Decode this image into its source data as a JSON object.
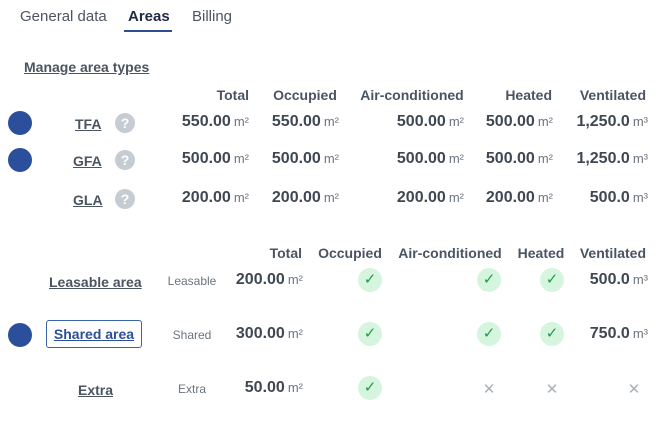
{
  "tabs": [
    {
      "label": "General data",
      "active": false
    },
    {
      "label": "Areas",
      "active": true
    },
    {
      "label": "Billing",
      "active": false
    }
  ],
  "manage_link": "Manage area types",
  "area_types_table": {
    "headers": [
      "Total",
      "Occupied",
      "Air-conditioned",
      "Heated",
      "Ventilated"
    ],
    "rows": [
      {
        "name": "TFA",
        "has_dot": true,
        "help": "?",
        "total": "550.00",
        "occupied": "550.00",
        "air_conditioned": "500.00",
        "heated": "500.00",
        "ventilated": "1,250.0"
      },
      {
        "name": "GFA",
        "has_dot": true,
        "help": "?",
        "total": "500.00",
        "occupied": "500.00",
        "air_conditioned": "500.00",
        "heated": "500.00",
        "ventilated": "1,250.0"
      },
      {
        "name": "GLA",
        "has_dot": false,
        "help": "?",
        "total": "200.00",
        "occupied": "200.00",
        "air_conditioned": "200.00",
        "heated": "200.00",
        "ventilated": "500.0"
      }
    ]
  },
  "areas_table": {
    "headers": [
      "Total",
      "Occupied",
      "Air-conditioned",
      "Heated",
      "Ventilated"
    ],
    "rows": [
      {
        "name": "Leasable area",
        "type": "Leasable",
        "has_dot": false,
        "total": "200.00",
        "occupied": true,
        "air_conditioned": true,
        "heated": true,
        "ventilated": "500.0"
      },
      {
        "name": "Shared area",
        "type": "Shared",
        "has_dot": true,
        "total": "300.00",
        "occupied": true,
        "air_conditioned": true,
        "heated": true,
        "ventilated": "750.0"
      },
      {
        "name": "Extra",
        "type": "Extra",
        "has_dot": false,
        "total": "50.00",
        "occupied": true,
        "air_conditioned": false,
        "heated": false,
        "ventilated": null
      }
    ]
  },
  "units": {
    "area": "m²",
    "volume": "m³"
  },
  "icons": {
    "check": "check-icon",
    "cross": "cross-icon",
    "help": "question-icon"
  },
  "colors": {
    "accent": "#2b4f9a",
    "check_bg": "#d6f5de",
    "check_fg": "#219a4a",
    "help_bg": "#c6ccd3"
  }
}
